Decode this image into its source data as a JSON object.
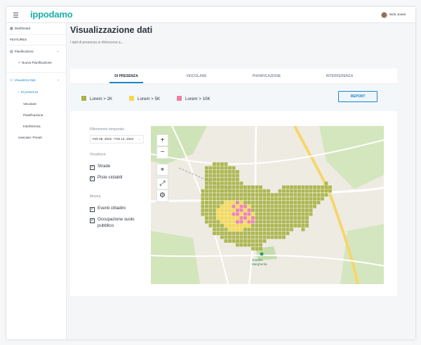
{
  "header": {
    "logo": "ippodamo",
    "user_name": "Nick Jones"
  },
  "sidebar": {
    "dashboard": "Dashboard",
    "section_label": "FEATURES",
    "pianificazioni": "Pianificazioni",
    "nuova_pianificazione": "Nuova Pianificazione",
    "visualizza_dati": "Visualizza Dati",
    "di_presenza": "Di presenza",
    "veicolare": "Veicolare",
    "pianificazione": "Pianificazione",
    "interferenza": "Interferenza",
    "usecase_preset": "Usecase: Preset"
  },
  "main": {
    "title": "Visualizzazione dati",
    "subtitle": "I dati di presenza si riferiscono a..."
  },
  "tabs": [
    "DI PRESENZA",
    "VEICOLARE",
    "PIANIFICAZIONE",
    "INTERFERENZA"
  ],
  "legend": {
    "items": [
      {
        "label": "Lorem > 2K",
        "color": "#a7b347"
      },
      {
        "label": "Lorem > 5K",
        "color": "#f5d84a"
      },
      {
        "label": "Lorem > 10K",
        "color": "#ee7fa0"
      }
    ],
    "report_button": "REPORT"
  },
  "filters": {
    "riferimento_label": "Riferimento temporale",
    "date_range": "Feb 08, 2022 - Feb 14, 2022",
    "visualizza_label": "Visualizza",
    "strade": "Strade",
    "piste": "Piste ciclabili",
    "mostra_label": "Mostra",
    "eventi": "Eventi cittadini",
    "occupazione_line1": "Occupazione suolo",
    "occupazione_line2": "pubblico"
  },
  "map": {
    "labels": {
      "giardini_1": "Giardini",
      "giardini_2": "Margherita"
    }
  }
}
